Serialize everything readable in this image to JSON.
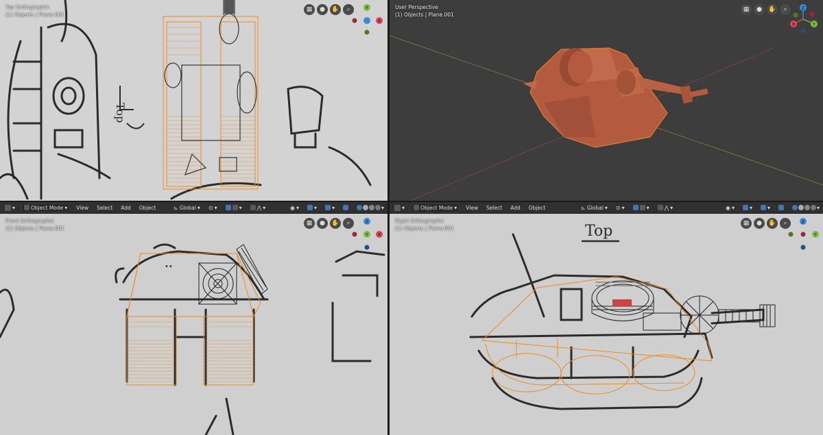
{
  "viewports": {
    "top": {
      "title": "Top Orthographic",
      "subtitle": "(1) Objects | Plane.001"
    },
    "persp": {
      "title": "User Perspective",
      "subtitle": "(1) Objects | Plane.001"
    },
    "front": {
      "title": "Front Orthographic",
      "subtitle": "(1) Objects | Plane.001"
    },
    "right": {
      "title": "Right Orthographic",
      "subtitle": "(1) Objects | Plane.001"
    }
  },
  "header": {
    "mode": "Object Mode",
    "menu": [
      "View",
      "Select",
      "Add",
      "Object"
    ],
    "transform_orientation": "Global"
  },
  "gizmo": {
    "x": "X",
    "y": "Y",
    "z": "Z"
  },
  "sketch_text": {
    "top_label": "Top",
    "side_label": "Top"
  },
  "colors": {
    "x_axis": "#e0455a",
    "y_axis": "#7dbc3a",
    "z_axis": "#3d8ad8",
    "selection": "#f08a1c",
    "mesh": "#b35a3f",
    "viewport_bg": "#3d3d3d",
    "paper": "#cfcfcf"
  },
  "icons": {
    "toggle_grid": "grid-icon",
    "camera": "camera-icon",
    "pan": "hand-icon",
    "zoom": "magnifier-icon"
  }
}
